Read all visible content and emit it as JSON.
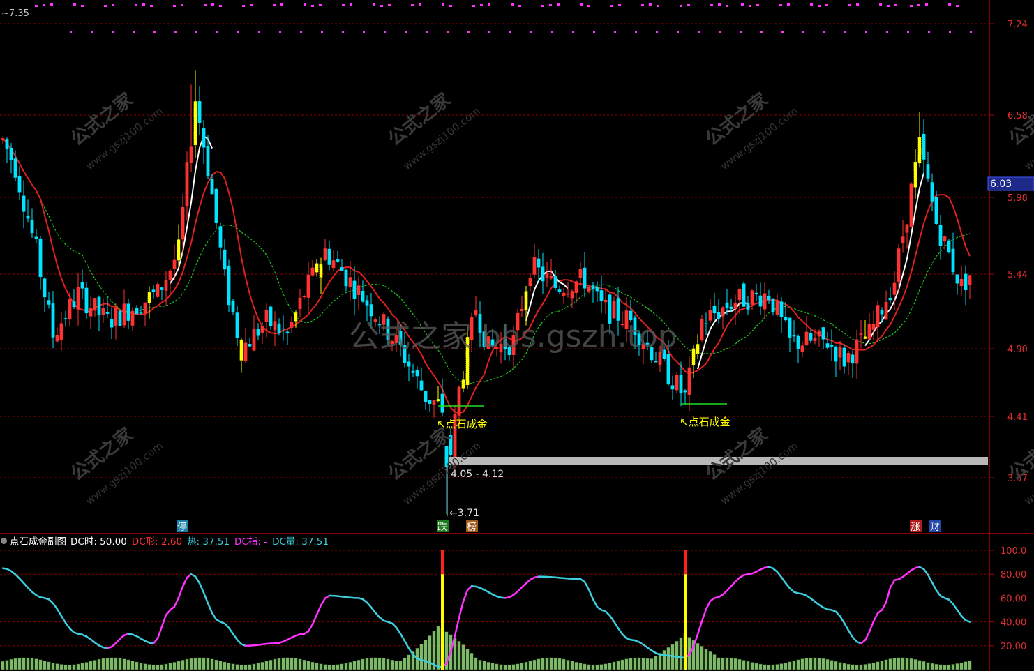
{
  "colors": {
    "bg": "#000000",
    "up": "#ff3232",
    "down": "#00e4ff",
    "yellow": "#ffff00",
    "grid": "#8b0000",
    "ma_red": "#e0201e",
    "ma_green": "#22c222",
    "ma_white": "#ffffff",
    "magenta": "#ff32ff",
    "cyan": "#3ccfe0",
    "volume": "#7fb86a",
    "current_price_box": "#1e2a8a"
  },
  "main": {
    "top_left_price": "7.35",
    "price_axis_labels": [
      "7.24",
      "6.58",
      "5.98",
      "5.44",
      "4.90",
      "4.41",
      "3.97"
    ],
    "current_price": "6.03",
    "min_label": "3.71",
    "range_label": "4.05 - 4.12",
    "signal_label": "点石成金",
    "watermark_center": "公式之家 bbs.gszh.top",
    "watermark_site": "公式之家 www.gszj100.com",
    "badges": [
      {
        "text": "停",
        "color": "#1a7fa8"
      },
      {
        "text": "跌",
        "color": "#1c7a1c"
      },
      {
        "text": "榜",
        "color": "#a05a1a"
      },
      {
        "text": "涨",
        "color": "#b01c1c"
      },
      {
        "text": "财",
        "color": "#2046a8"
      }
    ]
  },
  "sub": {
    "title": "点石成金副图",
    "indicators": [
      {
        "label": "DC时: 50.00",
        "color": "#ffffff"
      },
      {
        "label": "DC形: 2.60",
        "color": "#ff3232"
      },
      {
        "label": "热: 37.51",
        "color": "#3ccfe0"
      },
      {
        "label": "DC指: -",
        "color": "#ff32ff"
      },
      {
        "label": "DC量: 37.51",
        "color": "#3ccfe0"
      }
    ],
    "axis_labels": [
      "100.0",
      "80.00",
      "60.00",
      "40.00",
      "20.00"
    ]
  },
  "chart_data": {
    "type": "candlestick",
    "price_axis": {
      "ticks": [
        7.24,
        6.58,
        5.98,
        5.44,
        4.9,
        4.41,
        3.97
      ],
      "ylim": [
        3.6,
        7.4
      ]
    },
    "sub_axis": {
      "ticks": [
        100,
        80,
        60,
        40,
        20
      ],
      "ylim": [
        0,
        102
      ],
      "midline": 50
    },
    "key_points": {
      "peak_left": 6.8,
      "low": 3.71,
      "peak_right": 6.4,
      "last": 5.44
    },
    "support_range": [
      4.05,
      4.12
    ],
    "signal_days": [
      105,
      163
    ]
  }
}
